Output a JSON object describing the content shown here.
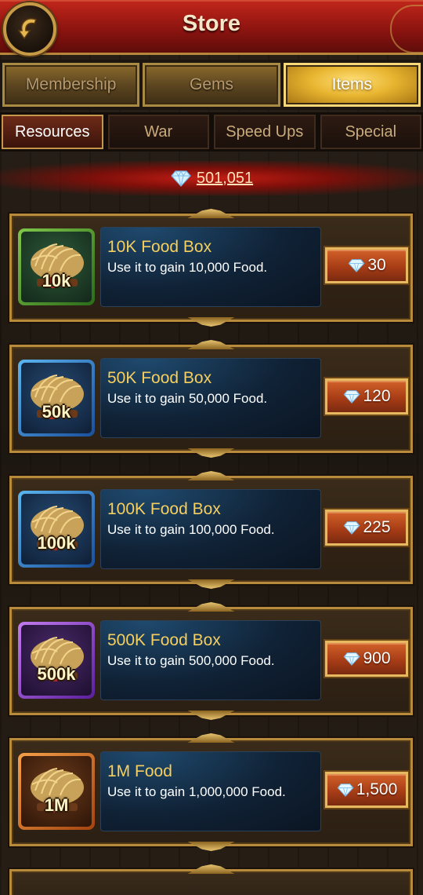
{
  "header": {
    "title": "Store",
    "back_icon": "back-arrow-icon"
  },
  "main_tabs": [
    {
      "label": "Membership",
      "active": false
    },
    {
      "label": "Gems",
      "active": false
    },
    {
      "label": "Items",
      "active": true
    }
  ],
  "sub_tabs": [
    {
      "label": "Resources",
      "active": true
    },
    {
      "label": "War",
      "active": false
    },
    {
      "label": "Speed Ups",
      "active": false
    },
    {
      "label": "Special",
      "active": false
    }
  ],
  "gems": {
    "icon": "gem-icon",
    "balance": "501,051"
  },
  "items": [
    {
      "name": "10K Food Box",
      "description": "Use it to gain 10,000 Food.",
      "amount_label": "10k",
      "price": "30",
      "rarity": "green"
    },
    {
      "name": "50K Food Box",
      "description": "Use it to gain 50,000 Food.",
      "amount_label": "50k",
      "price": "120",
      "rarity": "blue"
    },
    {
      "name": "100K Food Box",
      "description": "Use it to gain 100,000 Food.",
      "amount_label": "100k",
      "price": "225",
      "rarity": "blue"
    },
    {
      "name": "500K Food Box",
      "description": "Use it to gain 500,000 Food.",
      "amount_label": "500k",
      "price": "900",
      "rarity": "purple"
    },
    {
      "name": "1M Food",
      "description": "Use it to gain 1,000,000 Food.",
      "amount_label": "1M",
      "price": "1,500",
      "rarity": "orange"
    }
  ],
  "colors": {
    "header_red": "#a81d14",
    "gold_border": "#b88a3c",
    "item_name": "#f6cf5e",
    "active_tab_gold": "#e8b530",
    "buy_button": "#a83d16"
  }
}
